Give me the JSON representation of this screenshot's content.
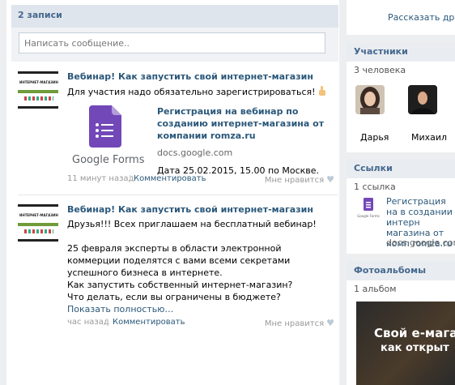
{
  "wall": {
    "count_label": "2 записи",
    "composer_placeholder": "Написать сообщение.."
  },
  "posts": [
    {
      "title": "Вебинар! Как запустить свой интернет-магазин",
      "text": "Для участия надо обязательно зарегистрироваться!",
      "thumb_label": "ИНТЕРНЕТ-МАГАЗИН",
      "attachment": {
        "brand": "Google Forms",
        "title": "Регистрация на вебинар по созданию интернет-магазина от компании romza.ru",
        "domain": "docs.google.com",
        "date": "Дата 25.02.2015, 15.00 по Москве."
      },
      "time": "11 минут назад",
      "comment": "Комментировать",
      "like": "Мне нравится"
    },
    {
      "title": "Вебинар! Как запустить свой интернет-магазин",
      "text": "Друзья!!! Всех приглашаем на бесплатный вебинар!\n\n25 февраля эксперты в области электронной коммерции поделятся с вами всеми секретами успешного бизнеса в интернете.\nКак запустить собственный интернет-магазин?\nЧто делать, если вы ограничены в бюджете?",
      "thumb_label": "ИНТЕРНЕТ-МАГАЗИН",
      "more": "Показать полностью…",
      "time": "час назад",
      "comment": "Комментировать",
      "like": "Мне нравится"
    }
  ],
  "sidebar": {
    "tell_friends": "Рассказать друзь",
    "members": {
      "title": "Участники",
      "count": "3 человека",
      "people": [
        {
          "name": "Дарья"
        },
        {
          "name": "Михаил"
        }
      ]
    },
    "links": {
      "title": "Ссылки",
      "count": "1 ссылка",
      "item_text": "Регистрация на в создании интерн магазина от комп romza.ru",
      "item_domain": "docs.google.com"
    },
    "albums": {
      "title": "Фотоальбомы",
      "count": "1 альбом",
      "cover_line1": "Свой e-магази",
      "cover_line2": "как открыт"
    }
  },
  "colors": {
    "accent": "#2b587a",
    "header_text": "#45688e",
    "header_bg": "#dfe5ec",
    "forms_purple": "#7248b9"
  }
}
